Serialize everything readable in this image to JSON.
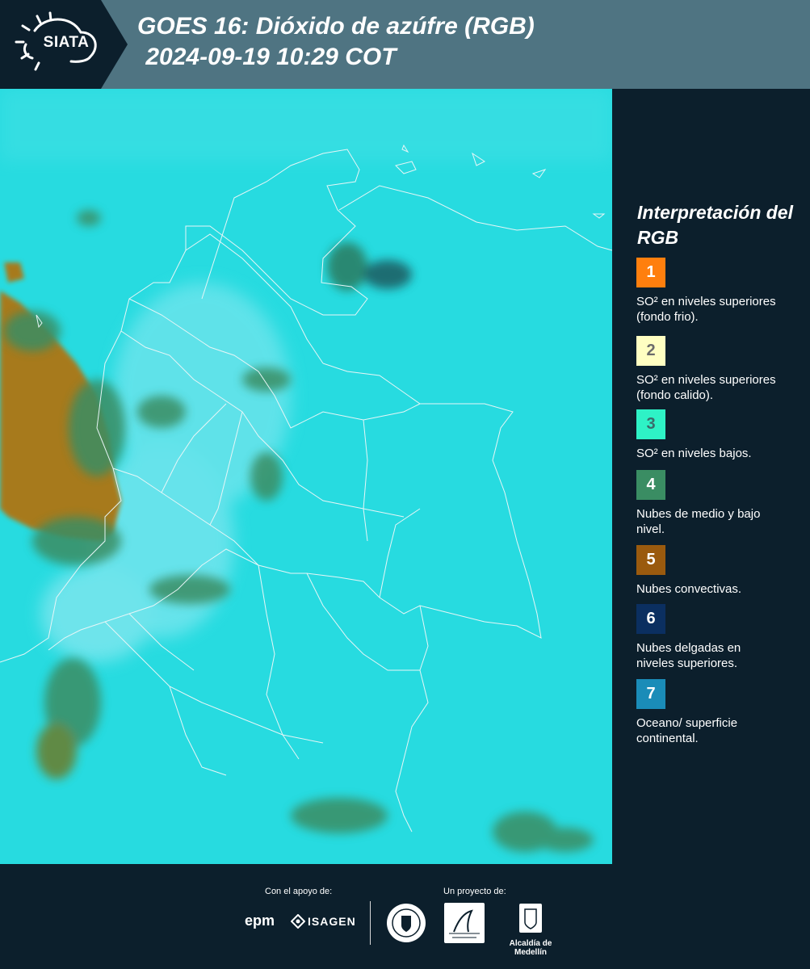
{
  "header": {
    "logo_text": "SIATA",
    "title_line1": "GOES 16: Dióxido de azúfre (RGB)",
    "title_line2": " 2024-09-19 10:29 COT"
  },
  "legend": {
    "title": "Interpretación del RGB",
    "items": [
      {
        "number": "1",
        "text": "SO² en niveles superiores (fondo frio).",
        "color": "#ff7f0e",
        "number_color": "#ffffff"
      },
      {
        "number": "2",
        "text": "SO² en niveles superiores (fondo calido).",
        "color": "#ffffc2",
        "number_color": "#6b6b6b"
      },
      {
        "number": "3",
        "text": "SO² en niveles bajos.",
        "color": "#2ef2c6",
        "number_color": "#3a6b6b"
      },
      {
        "number": "4",
        "text": "Nubes de medio y bajo nivel.",
        "color": "#3a8d63",
        "number_color": "#ffffff"
      },
      {
        "number": "5",
        "text": "Nubes convectivas.",
        "color": "#9a5a0e",
        "number_color": "#ffffff"
      },
      {
        "number": "6",
        "text": "Nubes delgadas en niveles superiores.",
        "color": "#0b2f60",
        "number_color": "#ffffff"
      },
      {
        "number": "7",
        "text": "Oceano/ superficie continental.",
        "color": "#1a8cb8",
        "number_color": "#ffffff"
      }
    ]
  },
  "footer": {
    "support_caption": "Con el apoyo de:",
    "project_caption": "Un proyecto de:",
    "epm_text": "epm",
    "isagen_text": "ISAGEN",
    "alcaldia_text": "Alcaldía de Medellín"
  },
  "colors": {
    "header_bg": "#4f7482",
    "panel_bg": "#0c1f2c",
    "map_base": "#27dbe0",
    "convective": "#a77a1e",
    "mid_cloud": "#3a8d63"
  }
}
